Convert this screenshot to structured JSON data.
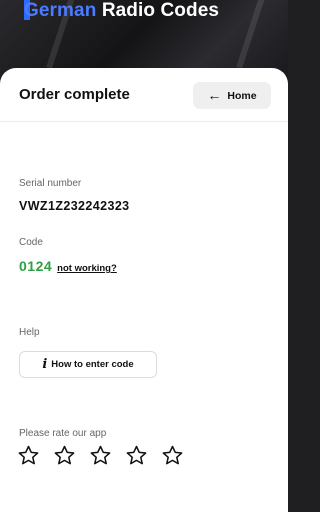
{
  "header": {
    "brand_accent": "German",
    "brand_rest": "Radio Codes",
    "accent_color": "#4b7bff"
  },
  "page": {
    "title": "Order complete",
    "home_label": "Home",
    "home_icon": "arrow-left-icon"
  },
  "details": {
    "serial_label": "Serial number",
    "serial_value": "VWZ1Z232242323",
    "code_label": "Code",
    "code_value": "0124",
    "code_color": "#2ea043",
    "not_working_label": "not working?"
  },
  "help": {
    "label": "Help",
    "button_label": "How to enter code",
    "button_icon": "info-icon"
  },
  "rating": {
    "label": "Please rate our app",
    "max_stars": 5,
    "selected": 0,
    "star_icon": "star-outline-icon"
  }
}
